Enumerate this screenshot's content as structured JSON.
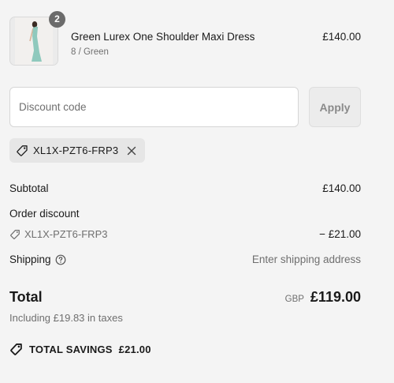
{
  "product": {
    "name": "Green Lurex One Shoulder Maxi Dress",
    "variant": "8 / Green",
    "price": "£140.00",
    "quantity": "2"
  },
  "discount": {
    "placeholder": "Discount code",
    "apply_label": "Apply",
    "applied_code": "XL1X-PZT6-FRP3"
  },
  "summary": {
    "subtotal_label": "Subtotal",
    "subtotal_value": "£140.00",
    "order_discount_label": "Order discount",
    "order_discount_code": "XL1X-PZT6-FRP3",
    "order_discount_value": "− £21.00",
    "shipping_label": "Shipping",
    "shipping_value": "Enter shipping address",
    "total_label": "Total",
    "currency": "GBP",
    "total_value": "£119.00",
    "taxes_note": "Including £19.83 in taxes",
    "savings_label": "TOTAL SAVINGS",
    "savings_value": "£21.00"
  },
  "icons": {
    "tag": "tag-icon",
    "close": "close-icon",
    "help": "question-circle-icon"
  },
  "colors": {
    "background": "#f4f4f4",
    "text": "#1a1a1a",
    "muted": "#6f6f6f",
    "badge": "#6b6b6b",
    "dress": "#8fc9bd"
  }
}
